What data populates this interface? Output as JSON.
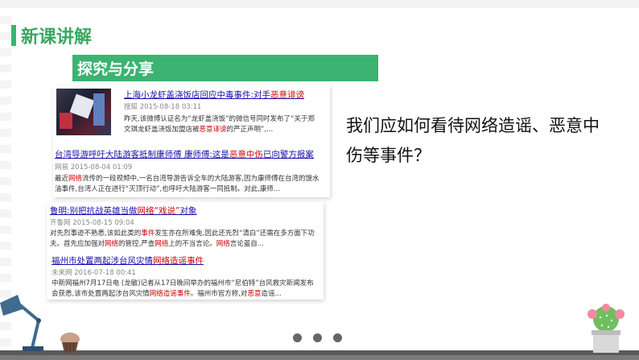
{
  "slide": {
    "section_title": "新课讲解",
    "banner": "探究与分享",
    "question": "我们应如何看待网络造谣、恶意中伤等事件？"
  },
  "news": [
    {
      "title_pre": "上海小龙虾盖浇饭店回应中毒事件:对手",
      "title_hl": "恶意诽谤",
      "source": "搜狐",
      "date": "2015-08-18 03:11",
      "body_l1": "昨天,该微博认证名为“龙虾盖浇饭”的微信号同时发布了“关于郑",
      "body_l2a": "文琪龙虾盖浇饭加盟店被",
      "body_l2hl": "恶意诽谤",
      "body_l2b": "的严正声明”,..."
    },
    {
      "title_pre": "台湾导游呼吁大陆游客抵制康师傅 康师傅:这是",
      "title_hl": "恶意中伤",
      "title_post": "已向警方报案",
      "source": "网易",
      "date": "2015-08-04 01:09",
      "body_l1a": "最近",
      "body_l1hl": "网络",
      "body_l1b": "流传的一段视频中,一名台湾导游告诉全车的大陆游客,因为康师傅在台湾的馊水",
      "body_l2": "油事件,台湾人正在进行“灭顶行动”,也呼吁大陆游客一同抵制。对此,康师..."
    },
    {
      "title_pre": "鲁明:别把抗战英雄当做",
      "title_hl": "网络",
      "title_hl2": "“戏说”",
      "title_post": "对象",
      "source": "齐鲁网",
      "date": "2015-08-15 09:04",
      "body_l1a": "对先烈事迹不熟悉,该如此类的",
      "body_l1hl": "事件",
      "body_l1b": "发生亦在所难免,因此还先烈“清白”还需在多方面下功",
      "body_l2a": "夫。首先应加强对",
      "body_l2hl": "网络",
      "body_l2b": "的管控,严查",
      "body_l2hl2": "网络",
      "body_l2c": "上的不当言论。",
      "body_l2hl3": "网络",
      "body_l2d": "言论虽自..."
    },
    {
      "title_pre": "福州市处置两起涉台风灾情",
      "title_hl": "网络造谣事件",
      "source": "未来网",
      "date": "2016-07-18 00:41",
      "body_l1": "中新网福州7月17日电 (龙敏)记者从17日晚间举办的福州市“尼伯特”台风救灾新闻发布",
      "body_l2a": "会获悉,该市处置两起涉台风灾情",
      "body_l2hl": "网络造谣事件",
      "body_l2b": "。福州市官方称,对",
      "body_l2hl2": "恶意",
      "body_l2c": "造谣..."
    }
  ],
  "colors": {
    "accent": "#3cb371",
    "link": "#1a0dab",
    "highlight": "#cc0000"
  }
}
